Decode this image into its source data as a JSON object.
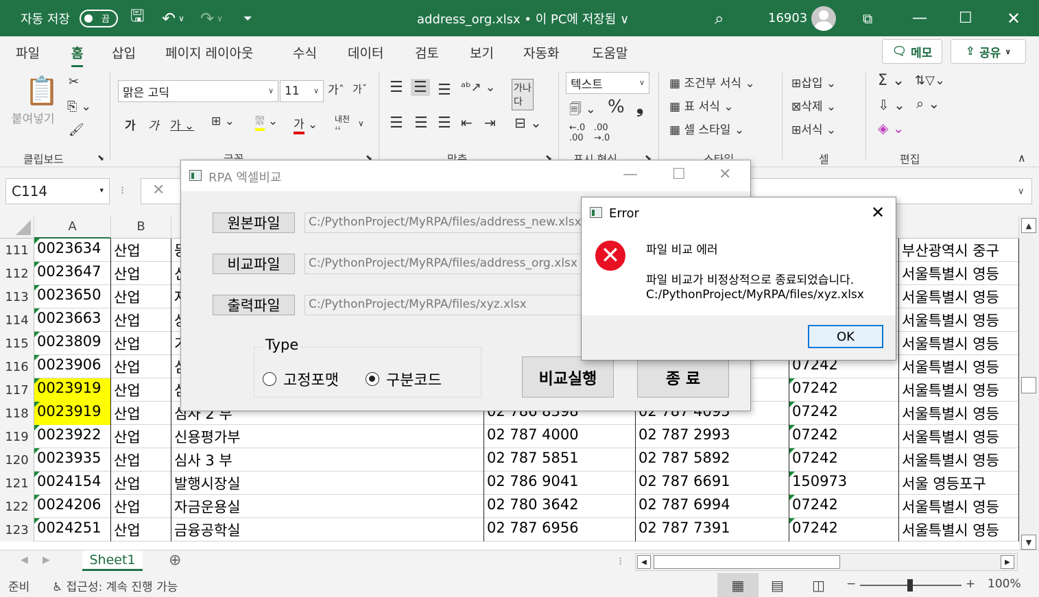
{
  "titlebar": {
    "autosave_label": "자동 저장",
    "autosave_state": "끔",
    "file_title": "address_org.xlsx • 이 PC에 저장됨 ∨",
    "user_id": "16903"
  },
  "tabs": [
    "파일",
    "홈",
    "삽입",
    "페이지 레이아웃",
    "수식",
    "데이터",
    "검토",
    "보기",
    "자동화",
    "도움말"
  ],
  "active_tab": "홈",
  "memo_label": "메모",
  "share_label": "공유",
  "ribbon": {
    "paste_label": "붙여넣기",
    "clipboard_group": "클립보드",
    "font_name": "맑은 고딕",
    "font_size": "11",
    "font_group": "글꼴",
    "align_group": "맞춤",
    "number_format": "텍스트",
    "number_group": "표시 형식",
    "cond_format": "조건부 서식",
    "table_format": "표 서식",
    "cell_style": "셀 스타일",
    "style_group": "스타일",
    "insert": "삽입",
    "delete": "삭제",
    "format": "서식",
    "cells_group": "셀",
    "edit_group": "편집"
  },
  "namebox": "C114",
  "columns": [
    "A",
    "B"
  ],
  "rows": [
    {
      "num": "111",
      "a": "0023634",
      "b": "산업",
      "c": "등",
      "d": "",
      "e": "",
      "f": "",
      "g": "부산광역시   중구"
    },
    {
      "num": "112",
      "a": "0023647",
      "b": "산업",
      "c": "신",
      "d": "",
      "e": "",
      "f": "",
      "g": "서울특별시   영등"
    },
    {
      "num": "113",
      "a": "0023650",
      "b": "산업",
      "c": "자",
      "d": "",
      "e": "",
      "f": "",
      "g": "서울특별시   영등"
    },
    {
      "num": "114",
      "a": "0023663",
      "b": "산업",
      "c": "상",
      "d": "",
      "e": "",
      "f": "",
      "g": "서울특별시   영등"
    },
    {
      "num": "115",
      "a": "0023809",
      "b": "산업",
      "c": "기",
      "d": "",
      "e": "",
      "f": "",
      "g": "서울특별시   영등"
    },
    {
      "num": "116",
      "a": "0023906",
      "b": "산업",
      "c": "심",
      "d": "",
      "e": "",
      "f": "07242",
      "g": "서울특별시   영등"
    },
    {
      "num": "117",
      "a": "0023919",
      "b": "산업",
      "c": "심",
      "d": "",
      "e": "",
      "f": "07242",
      "g": "서울특별시   영등"
    },
    {
      "num": "118",
      "a": "0023919",
      "b": "산업",
      "c": "심사 2 부",
      "d": "02 786 8398",
      "e": "02 787 4095",
      "f": "07242",
      "g": "서울특별시   영등"
    },
    {
      "num": "119",
      "a": "0023922",
      "b": "산업",
      "c": "신용평가부",
      "d": "02 787 4000",
      "e": "02 787 2993",
      "f": "07242",
      "g": "서울특별시   영등"
    },
    {
      "num": "120",
      "a": "0023935",
      "b": "산업",
      "c": "심사 3 부",
      "d": "02 787 5851",
      "e": "02 787 5892",
      "f": "07242",
      "g": "서울특별시   영등"
    },
    {
      "num": "121",
      "a": "0024154",
      "b": "산업",
      "c": "발행시장실",
      "d": "02 786 9041",
      "e": "02 787 6691",
      "f": "150973",
      "g": "서울   영등포구"
    },
    {
      "num": "122",
      "a": "0024206",
      "b": "산업",
      "c": "자금운용실",
      "d": "02 780 3642",
      "e": "02 787 6994",
      "f": "07242",
      "g": "서울특별시   영등"
    },
    {
      "num": "123",
      "a": "0024251",
      "b": "산업",
      "c": "금융공학실",
      "d": "02 787 6956",
      "e": "02 787 7391",
      "f": "07242",
      "g": "서울특별시   영등"
    }
  ],
  "sheet_tab": "Sheet1",
  "status": {
    "ready": "준비",
    "accessibility": "접근성: 계속 진행 가능",
    "zoom": "100%"
  },
  "rpa_dialog": {
    "title": "RPA 엑셀비교",
    "src_label": "원본파일",
    "src_path": "C:/PythonProject/MyRPA/files/address_new.xlsx",
    "cmp_label": "비교파일",
    "cmp_path": "C:/PythonProject/MyRPA/files/address_org.xlsx",
    "out_label": "출력파일",
    "out_path": "C:/PythonProject/MyRPA/files/xyz.xlsx",
    "type_legend": "Type",
    "radio_fixed": "고정포맷",
    "radio_code": "구분코드",
    "run_label": "비교실행",
    "quit_label": "종 료"
  },
  "error_dialog": {
    "title": "Error",
    "heading": "파일 비교 에러",
    "line1": "파일 비교가 비정상적으로 종료되었습니다.",
    "line2": "C:/PythonProject/MyRPA/files/xyz.xlsx",
    "ok_label": "OK"
  },
  "colors": {
    "excel_green": "#217346",
    "highlight": "#ffff00",
    "error_red": "#e81123",
    "focus_blue": "#0078d7"
  }
}
